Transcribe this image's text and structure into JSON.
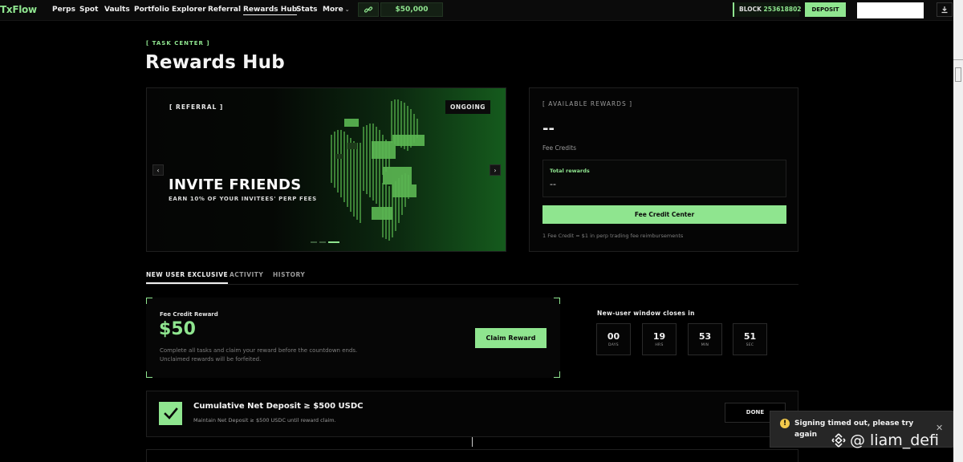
{
  "nav": {
    "logo": "TxFlow",
    "items": [
      {
        "label": "Perps"
      },
      {
        "label": "Spot"
      },
      {
        "label": "Vaults"
      },
      {
        "label": "Portfolio"
      },
      {
        "label": "Explorer"
      },
      {
        "label": "Referral"
      },
      {
        "label": "Rewards Hub"
      },
      {
        "label": "Stats"
      },
      {
        "label": "More"
      }
    ],
    "active": "Rewards Hub",
    "link_icon": "link-icon",
    "balance": "$50,000",
    "block_label": "BLOCK",
    "block_number": "253618802",
    "deposit_label": "DEPOSIT",
    "download_icon": "download-icon"
  },
  "header": {
    "eyebrow": "[ TASK CENTER ]",
    "title": "Rewards Hub"
  },
  "hero": {
    "tag": "[ REFERRAL ]",
    "status": "ONGOING",
    "title": "INVITE FRIENDS",
    "subtitle": "EARN 10% OF YOUR INVITEES' PERP FEES",
    "prev_icon": "chevron-left-icon",
    "next_icon": "chevron-right-icon",
    "slides": 3,
    "active_slide": 3
  },
  "rewards": {
    "tag": "[ AVAILABLE REWARDS ]",
    "value": "--",
    "unit_label": "Fee Credits",
    "total_label": "Total rewards",
    "total_value": "--",
    "button": "Fee Credit Center",
    "note": "1 Fee Credit = $1 in perp trading fee reimbursements"
  },
  "tabs": [
    {
      "label": "NEW USER EXCLUSIVE",
      "active": true
    },
    {
      "label": "ACTIVITY",
      "active": false
    },
    {
      "label": "HISTORY",
      "active": false
    }
  ],
  "fee_reward": {
    "label": "Fee Credit Reward",
    "amount": "$50",
    "desc_line1": "Complete all tasks and claim your reward before the countdown ends.",
    "desc_line2": "Unclaimed rewards will be forfeited.",
    "button": "Claim Reward"
  },
  "countdown": {
    "title": "New-user window closes in",
    "units": [
      {
        "value": "00",
        "unit": "DAYS"
      },
      {
        "value": "19",
        "unit": "HRS"
      },
      {
        "value": "53",
        "unit": "MIN"
      },
      {
        "value": "51",
        "unit": "SEC"
      }
    ]
  },
  "task": {
    "title": "Cumulative Net Deposit ≥ $500 USDC",
    "desc": "Maintain Net Deposit ≥ $500 USDC until reward claim.",
    "status": "DONE",
    "icon": "checkmark-icon"
  },
  "toast": {
    "message": "Signing timed out, please try again",
    "icon": "warning-icon",
    "close_icon": "close-icon"
  },
  "watermark": "@ liam_defi",
  "colors": {
    "accent": "#8fe58f",
    "background": "#000000",
    "warning": "#f2c94c"
  }
}
